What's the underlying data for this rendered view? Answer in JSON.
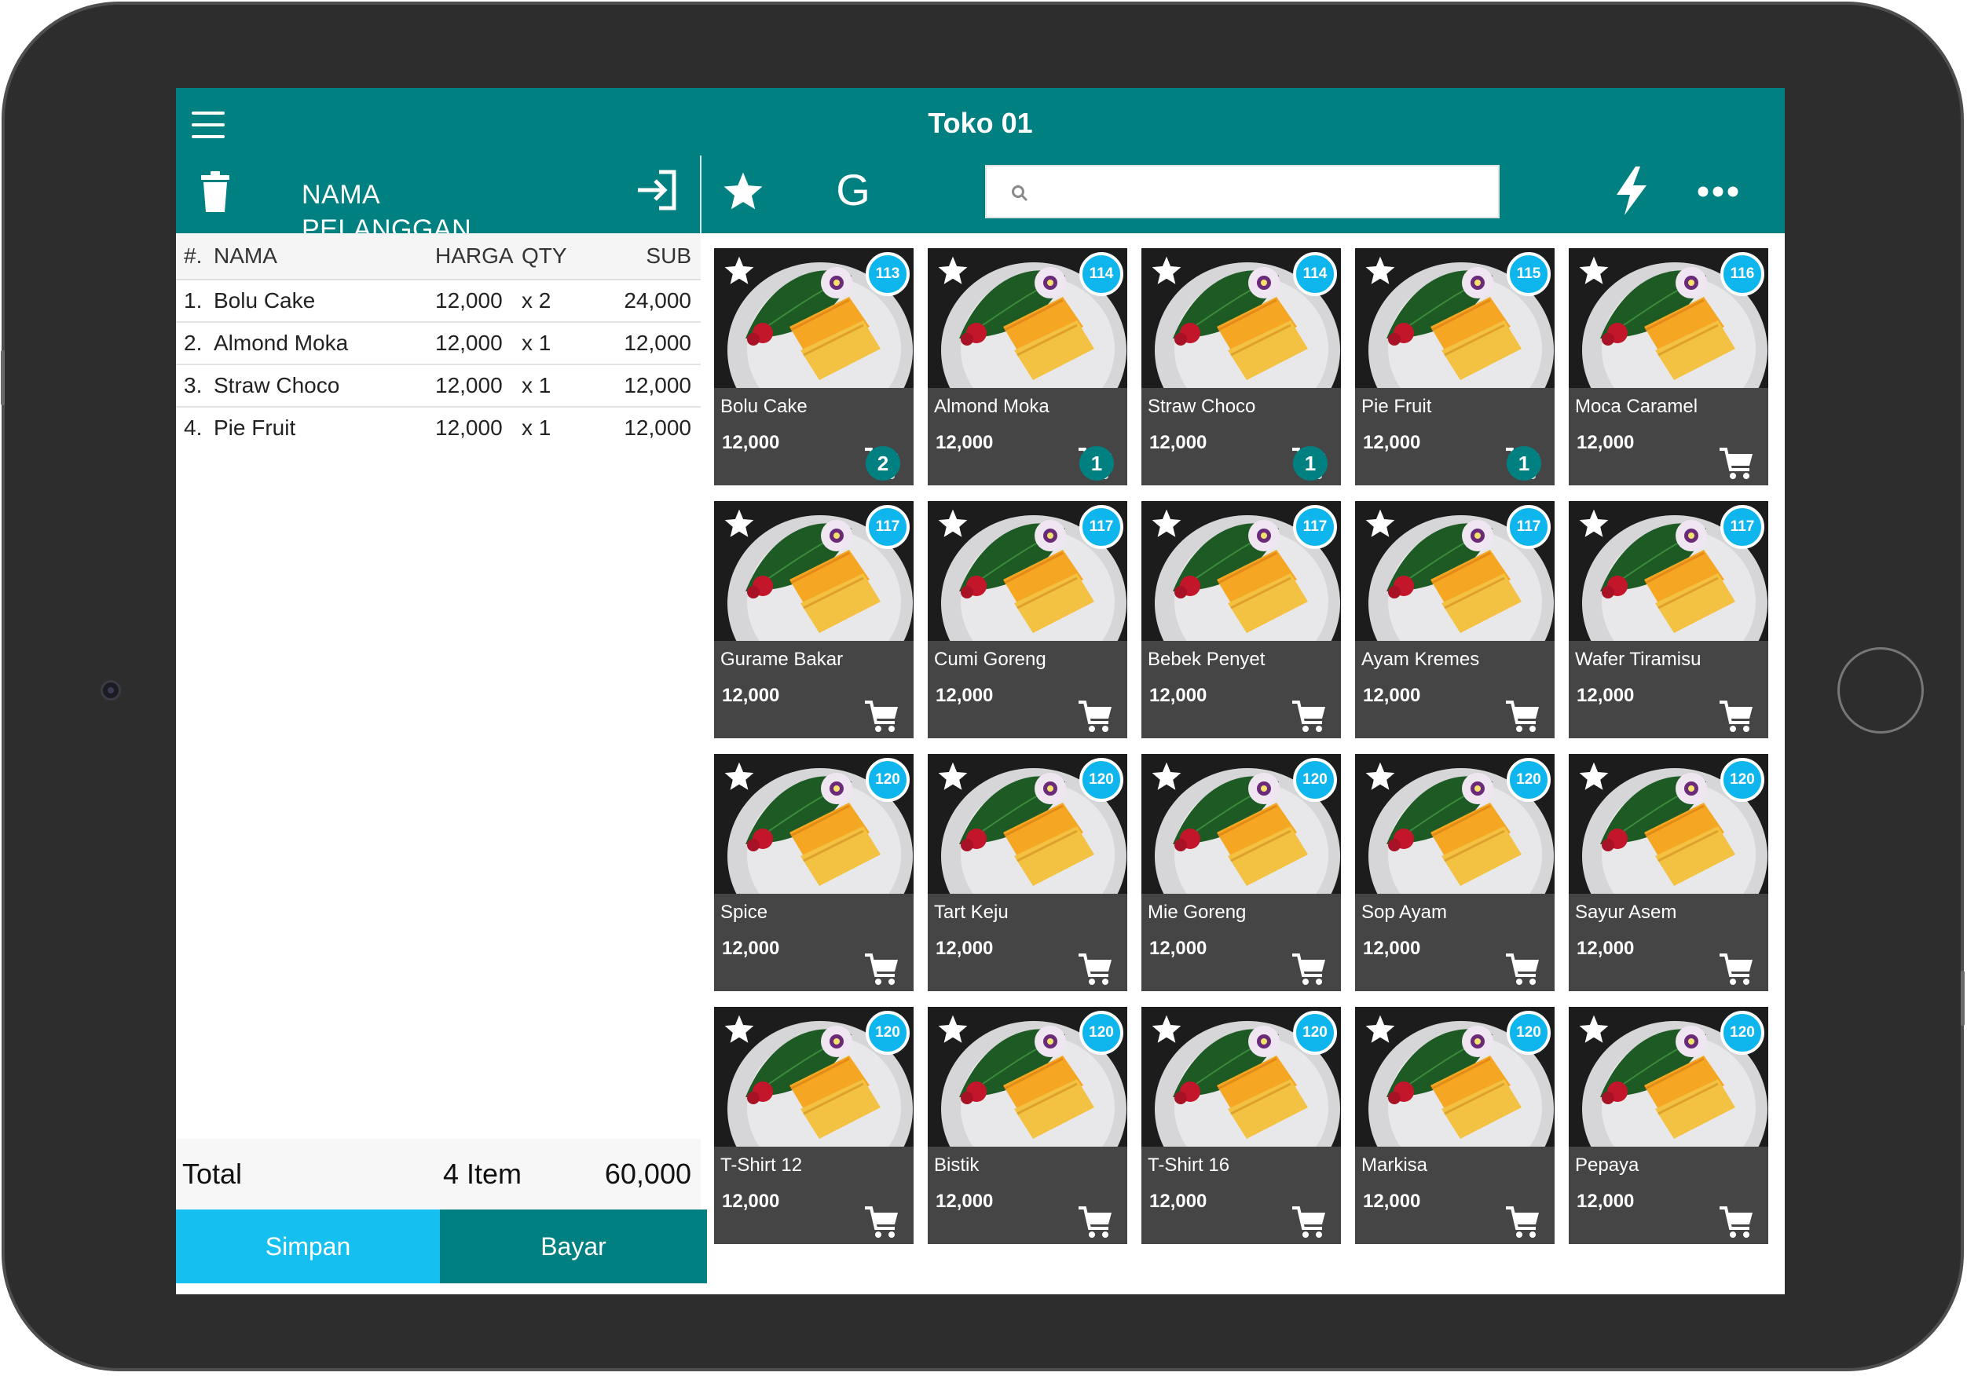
{
  "header": {
    "title": "Toko 01",
    "customer_label": "NAMA PELANGGAN",
    "g_label": "G",
    "search_placeholder": ""
  },
  "order": {
    "columns": {
      "num": "#.",
      "name": "NAMA",
      "price": "HARGA",
      "qty": "QTY",
      "sub": "SUB"
    },
    "rows": [
      {
        "num": "1.",
        "name": "Bolu Cake",
        "price": "12,000",
        "qty": "x 2",
        "sub": "24,000"
      },
      {
        "num": "2.",
        "name": "Almond Moka",
        "price": "12,000",
        "qty": "x 1",
        "sub": "12,000"
      },
      {
        "num": "3.",
        "name": "Straw Choco",
        "price": "12,000",
        "qty": "x 1",
        "sub": "12,000"
      },
      {
        "num": "4.",
        "name": "Pie Fruit",
        "price": "12,000",
        "qty": "x 1",
        "sub": "12,000"
      }
    ],
    "total_label": "Total",
    "total_items": "4 Item",
    "total_amount": "60,000",
    "save_label": "Simpan",
    "pay_label": "Bayar"
  },
  "products": [
    {
      "name": "Bolu Cake",
      "price": "12,000",
      "stock": "113",
      "qty": "2"
    },
    {
      "name": "Almond Moka",
      "price": "12,000",
      "stock": "114",
      "qty": "1"
    },
    {
      "name": "Straw Choco",
      "price": "12,000",
      "stock": "114",
      "qty": "1"
    },
    {
      "name": "Pie Fruit",
      "price": "12,000",
      "stock": "115",
      "qty": "1"
    },
    {
      "name": "Moca Caramel",
      "price": "12,000",
      "stock": "116",
      "qty": ""
    },
    {
      "name": "Gurame Bakar",
      "price": "12,000",
      "stock": "117",
      "qty": ""
    },
    {
      "name": "Cumi Goreng",
      "price": "12,000",
      "stock": "117",
      "qty": ""
    },
    {
      "name": "Bebek Penyet",
      "price": "12,000",
      "stock": "117",
      "qty": ""
    },
    {
      "name": "Ayam Kremes",
      "price": "12,000",
      "stock": "117",
      "qty": ""
    },
    {
      "name": "Wafer Tiramisu",
      "price": "12,000",
      "stock": "117",
      "qty": ""
    },
    {
      "name": "Spice",
      "price": "12,000",
      "stock": "120",
      "qty": ""
    },
    {
      "name": "Tart Keju",
      "price": "12,000",
      "stock": "120",
      "qty": ""
    },
    {
      "name": "Mie Goreng",
      "price": "12,000",
      "stock": "120",
      "qty": ""
    },
    {
      "name": "Sop Ayam",
      "price": "12,000",
      "stock": "120",
      "qty": ""
    },
    {
      "name": "Sayur Asem",
      "price": "12,000",
      "stock": "120",
      "qty": ""
    },
    {
      "name": "T-Shirt 12",
      "price": "12,000",
      "stock": "120",
      "qty": ""
    },
    {
      "name": "Bistik",
      "price": "12,000",
      "stock": "120",
      "qty": ""
    },
    {
      "name": "T-Shirt 16",
      "price": "12,000",
      "stock": "120",
      "qty": ""
    },
    {
      "name": "Markisa",
      "price": "12,000",
      "stock": "120",
      "qty": ""
    },
    {
      "name": "Pepaya",
      "price": "12,000",
      "stock": "120",
      "qty": ""
    }
  ],
  "colors": {
    "primary": "#008080",
    "accent": "#15c0f1",
    "card_bg": "#454545"
  },
  "icons": [
    "menu-icon",
    "trash-icon",
    "login-icon",
    "star-icon",
    "search-icon",
    "bolt-icon",
    "more-icon",
    "cart-icon"
  ]
}
